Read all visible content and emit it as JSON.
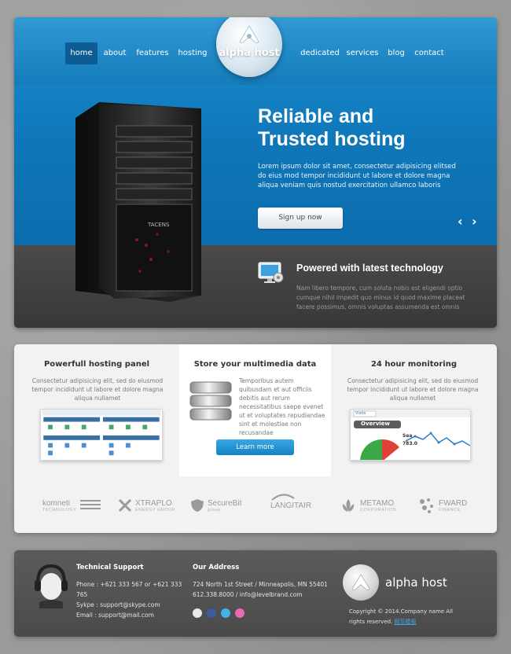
{
  "nav": {
    "items": [
      {
        "label": "home",
        "active": true
      },
      {
        "label": "about"
      },
      {
        "label": "features"
      },
      {
        "label": "hosting"
      },
      {
        "label": "dedicated"
      },
      {
        "label": "services"
      },
      {
        "label": "blog"
      },
      {
        "label": "contact"
      }
    ]
  },
  "brand": {
    "name": "alpha host"
  },
  "hero": {
    "title_line1": "Reliable and",
    "title_line2": "Trusted hosting",
    "text": "Lorem ipsum dolor sit amet, consectetur adipisicing elitsed do eius mod tempor incididunt ut labore et dolore magna aliqua veniam quis nostud exercitation ullamco laboris",
    "signup_label": "Sign up now",
    "prev": "‹",
    "next": "›",
    "tech_title": "Powered with latest technology",
    "tech_text": "Nam libero tempore, cum soluta nobis est eligendi optio cumque nihil impedit quo minus id quod maxime placeat facere possimus, omnis voluptas assumenda est omnis"
  },
  "features": {
    "panel": {
      "title": "Powerfull hosting panel",
      "text": "Consectetur adipisicing elit, sed do eiusmod tempor incididunt ut labore et dolore magna aliqua nullamet"
    },
    "media": {
      "title": "Store your multimedia data",
      "text": "Temporibus autem quibusdam et aut officiis debitis aut rerum necessitatibus saepe evenet ut et voluptates repudiandae sint et molestiae non recusandae",
      "button": "Learn more"
    },
    "monitor": {
      "title": "24 hour monitoring",
      "text": "Consectetur adipisicing elit, sed do eiusmod tempor incididunt ut labore et dolore magna aliqua nullamet",
      "chart_overview": "Overview",
      "chart_tab": "Visits",
      "chart_value": "783.0",
      "chart_seg": "Sea"
    },
    "partners": [
      {
        "name": "komneti",
        "sub": "TECHNOLOGY"
      },
      {
        "name": "XTRAPLO",
        "sub": "ENERGY GROUP"
      },
      {
        "name": "SecureBit",
        "sub": "group"
      },
      {
        "name": "LANGITAIR",
        "sub": ""
      },
      {
        "name": "METAMO",
        "sub": "CORPORATION"
      },
      {
        "name": "FWARD",
        "sub": "FINANCE"
      }
    ]
  },
  "footer": {
    "support_title": "Technical Support",
    "phone": "Phone : +621 333 567 or +621 333 765",
    "skype": "Sykpe : support@skype.com",
    "email": "Email : support@mail.com",
    "address_title": "Our Address",
    "address": "724 North 1st Street / Minneapolis, MN 55401",
    "address2": "612.338.8000 / info@levelbrand.com",
    "copyright": "Copyright © 2014.Company name All rights reserved.",
    "copyright_link": "网页模板"
  },
  "colors": {
    "accent": "#1582c5",
    "hero_blue": "#0f77b9",
    "footer": "#4f4f4f"
  }
}
